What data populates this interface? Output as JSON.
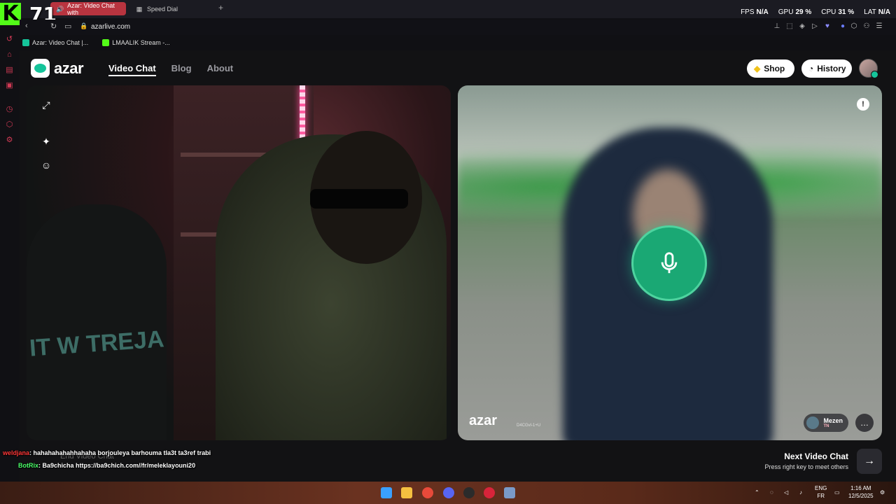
{
  "browser": {
    "tabs": [
      {
        "label": "Azar: Video Chat with",
        "active": true
      },
      {
        "label": "Speed Dial",
        "active": false
      }
    ],
    "url": "azarlive.com",
    "bookmarks": [
      "Azar: Video Chat |...",
      "LMAALIK Stream -..."
    ]
  },
  "stream_overlay": {
    "viewer_count": "71",
    "perf": {
      "fps_label": "FPS",
      "fps": "N/A",
      "gpu_label": "GPU",
      "gpu": "29 %",
      "cpu_label": "CPU",
      "cpu": "31 %",
      "lat_label": "LAT",
      "lat": "N/A"
    },
    "chat": [
      {
        "user": "weldjana",
        "message": ": hahahahahahhahaha borjouleya barhouma tla3t ta3ref trabi"
      },
      {
        "user": "BotRix",
        "message": ": Ba9chicha https://ba9chich.com//fr/meleklayouni20"
      }
    ]
  },
  "site": {
    "logo": "azar",
    "nav": {
      "video_chat": "Video Chat",
      "blog": "Blog",
      "about": "About"
    },
    "shop_label": "Shop",
    "history_label": "History",
    "end_chat": "End Video Chat",
    "next_title": "Next Video Chat",
    "next_sub": "Press right key to meet others",
    "watermark": "azar",
    "room_code": "D4CGvl-1+U",
    "peer": {
      "name": "Mezen",
      "country": "TN"
    },
    "left_shirt_text": "IT W TREJA"
  },
  "taskbar": {
    "lang": "ENG",
    "lang_sub": "FR",
    "time": "1:16 AM",
    "date": "12/5/2025"
  },
  "colors": {
    "accent": "#1aa874",
    "tab_active": "#b8343f",
    "kick_green": "#53fc18"
  }
}
